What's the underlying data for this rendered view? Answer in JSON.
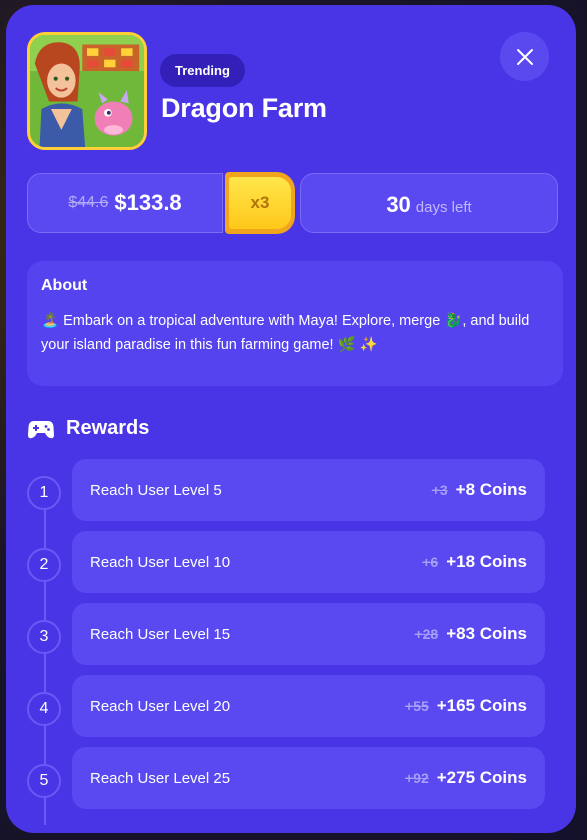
{
  "header": {
    "badge": "Trending",
    "title": "Dragon Farm"
  },
  "price": {
    "old": "$44.6",
    "new": "$133.8",
    "multiplier": "x3"
  },
  "duration": {
    "value": "30",
    "label": "days left"
  },
  "about": {
    "title": "About",
    "text": "🏝️ Embark on a tropical adventure with Maya! Explore, merge 🐉, and build your island paradise in this fun farming game! 🌿 ✨"
  },
  "rewards": {
    "title": "Rewards",
    "items": [
      {
        "step": "1",
        "label": "Reach User Level 5",
        "old": "+3",
        "new": "+8 Coins"
      },
      {
        "step": "2",
        "label": "Reach User Level 10",
        "old": "+6",
        "new": "+18 Coins"
      },
      {
        "step": "3",
        "label": "Reach User Level 15",
        "old": "+28",
        "new": "+83 Coins"
      },
      {
        "step": "4",
        "label": "Reach User Level 20",
        "old": "+55",
        "new": "+165 Coins"
      },
      {
        "step": "5",
        "label": "Reach User Level 25",
        "old": "+92",
        "new": "+275 Coins"
      }
    ]
  },
  "icons": {
    "close": "close-icon",
    "rewards": "gamepad-icon",
    "app": "dragon-farm-app-icon"
  },
  "colors": {
    "modal_bg": "#4a35e6",
    "card_bg": "#5a48f0",
    "multiplier": "#ffc81a"
  }
}
